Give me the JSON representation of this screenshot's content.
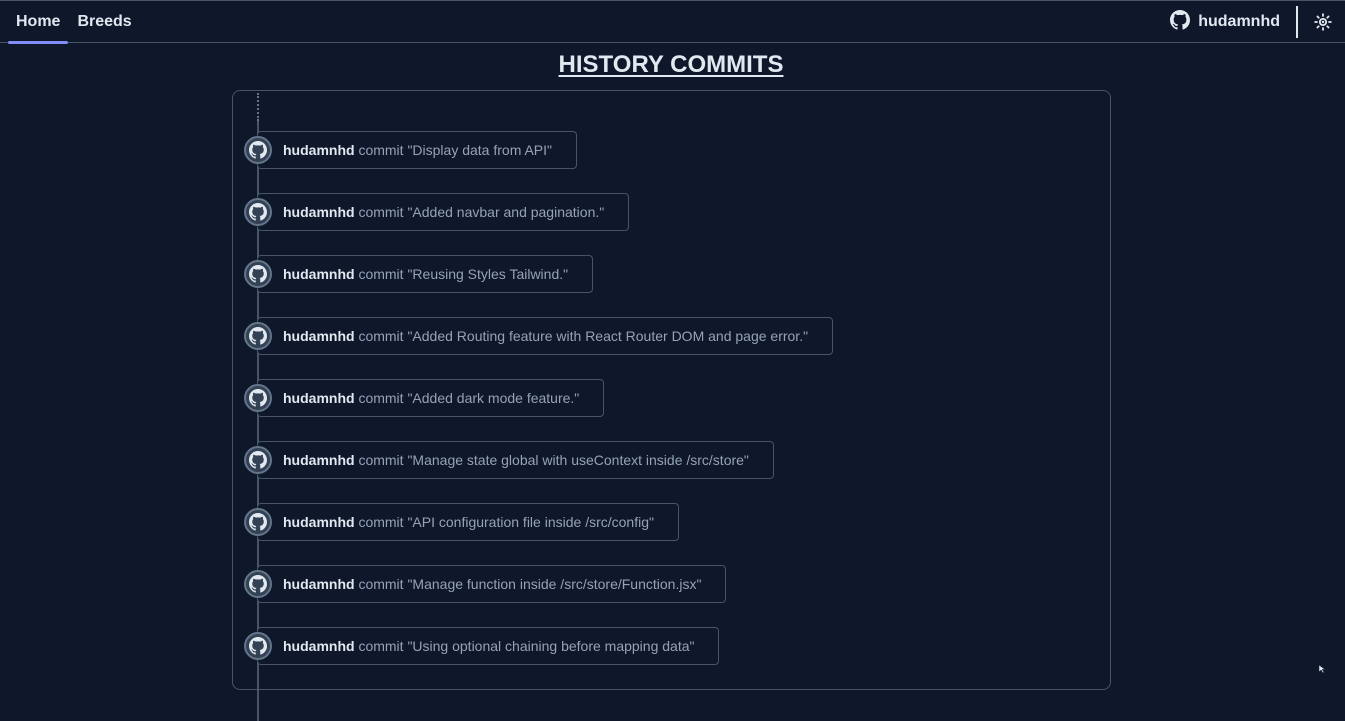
{
  "nav": {
    "tabs": [
      {
        "label": "Home",
        "active": true
      },
      {
        "label": "Breeds",
        "active": false
      }
    ],
    "profile_name": "hudamnhd",
    "profile_icon": "github-icon",
    "theme_icon": "sun-icon"
  },
  "page": {
    "title": "HISTORY COMMITS"
  },
  "commits": [
    {
      "user": "hudamnhd",
      "verb": "commit",
      "message": "\"Display data from API\""
    },
    {
      "user": "hudamnhd",
      "verb": "commit",
      "message": "\"Added navbar and pagination.\""
    },
    {
      "user": "hudamnhd",
      "verb": "commit",
      "message": "\"Reusing Styles Tailwind.\""
    },
    {
      "user": "hudamnhd",
      "verb": "commit",
      "message": "\"Added Routing feature with React Router DOM and page error.\""
    },
    {
      "user": "hudamnhd",
      "verb": "commit",
      "message": "\"Added dark mode feature.\""
    },
    {
      "user": "hudamnhd",
      "verb": "commit",
      "message": "\"Manage state global with useContext inside /src/store\""
    },
    {
      "user": "hudamnhd",
      "verb": "commit",
      "message": "\"API configuration file inside /src/config\""
    },
    {
      "user": "hudamnhd",
      "verb": "commit",
      "message": "\"Manage function inside /src/store/Function.jsx\""
    },
    {
      "user": "hudamnhd",
      "verb": "commit",
      "message": "\"Using optional chaining before mapping data\""
    }
  ],
  "colors": {
    "background": "#0f172a",
    "border": "#475569",
    "accent": "#818cf8",
    "text": "#e2e8f0",
    "muted_text": "#94a3b8"
  }
}
